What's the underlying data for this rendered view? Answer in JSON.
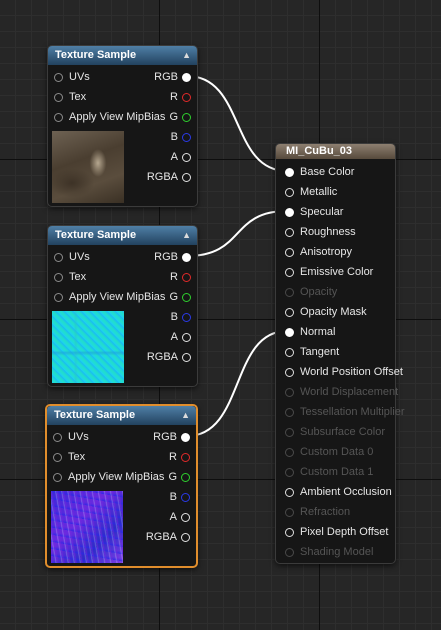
{
  "texture_nodes": [
    {
      "title": "Texture Sample",
      "collapse_glyph": "▲",
      "selected": false,
      "inputs": [
        {
          "label": "UVs"
        },
        {
          "label": "Tex"
        },
        {
          "label": "Apply View MipBias"
        }
      ],
      "outputs": [
        {
          "label": "RGB",
          "connected": true
        },
        {
          "label": "R",
          "connected": false
        },
        {
          "label": "G",
          "connected": false
        },
        {
          "label": "B",
          "connected": false
        },
        {
          "label": "A",
          "connected": false
        },
        {
          "label": "RGBA",
          "connected": false
        }
      ],
      "thumbnail": "diffuse-texture"
    },
    {
      "title": "Texture Sample",
      "collapse_glyph": "▲",
      "selected": false,
      "inputs": [
        {
          "label": "UVs"
        },
        {
          "label": "Tex"
        },
        {
          "label": "Apply View MipBias"
        }
      ],
      "outputs": [
        {
          "label": "RGB",
          "connected": true
        },
        {
          "label": "R",
          "connected": false
        },
        {
          "label": "G",
          "connected": false
        },
        {
          "label": "B",
          "connected": false
        },
        {
          "label": "A",
          "connected": false
        },
        {
          "label": "RGBA",
          "connected": false
        }
      ],
      "thumbnail": "specular-texture"
    },
    {
      "title": "Texture Sample",
      "collapse_glyph": "▲",
      "selected": true,
      "inputs": [
        {
          "label": "UVs"
        },
        {
          "label": "Tex"
        },
        {
          "label": "Apply View MipBias"
        }
      ],
      "outputs": [
        {
          "label": "RGB",
          "connected": true
        },
        {
          "label": "R",
          "connected": false
        },
        {
          "label": "G",
          "connected": false
        },
        {
          "label": "B",
          "connected": false
        },
        {
          "label": "A",
          "connected": false
        },
        {
          "label": "RGBA",
          "connected": false
        }
      ],
      "thumbnail": "normal-texture"
    }
  ],
  "material_node": {
    "title": "MI_CuBu_03",
    "pins": [
      {
        "label": "Base Color",
        "enabled": true,
        "connected": true
      },
      {
        "label": "Metallic",
        "enabled": true,
        "connected": false
      },
      {
        "label": "Specular",
        "enabled": true,
        "connected": true
      },
      {
        "label": "Roughness",
        "enabled": true,
        "connected": false
      },
      {
        "label": "Anisotropy",
        "enabled": true,
        "connected": false
      },
      {
        "label": "Emissive Color",
        "enabled": true,
        "connected": false
      },
      {
        "label": "Opacity",
        "enabled": false,
        "connected": false
      },
      {
        "label": "Opacity Mask",
        "enabled": true,
        "connected": false
      },
      {
        "label": "Normal",
        "enabled": true,
        "connected": true
      },
      {
        "label": "Tangent",
        "enabled": true,
        "connected": false
      },
      {
        "label": "World Position Offset",
        "enabled": true,
        "connected": false
      },
      {
        "label": "World Displacement",
        "enabled": false,
        "connected": false
      },
      {
        "label": "Tessellation Multiplier",
        "enabled": false,
        "connected": false
      },
      {
        "label": "Subsurface Color",
        "enabled": false,
        "connected": false
      },
      {
        "label": "Custom Data 0",
        "enabled": false,
        "connected": false
      },
      {
        "label": "Custom Data 1",
        "enabled": false,
        "connected": false
      },
      {
        "label": "Ambient Occlusion",
        "enabled": true,
        "connected": false
      },
      {
        "label": "Refraction",
        "enabled": false,
        "connected": false
      },
      {
        "label": "Pixel Depth Offset",
        "enabled": true,
        "connected": false
      },
      {
        "label": "Shading Model",
        "enabled": false,
        "connected": false
      }
    ]
  },
  "connections": [
    {
      "from": "texture-node-1.RGB",
      "to": "Base Color"
    },
    {
      "from": "texture-node-2.RGB",
      "to": "Specular"
    },
    {
      "from": "texture-node-3.RGB",
      "to": "Normal"
    }
  ],
  "colors": {
    "grid_background": "#262626",
    "texture_header": "#3a6a90",
    "material_header": "#7a6b5d",
    "selection_outline": "#e08d2c",
    "wire": "#ffffff",
    "pin_red": "#e02a2a",
    "pin_green": "#2ecf2e",
    "pin_blue": "#2a3ae6"
  }
}
